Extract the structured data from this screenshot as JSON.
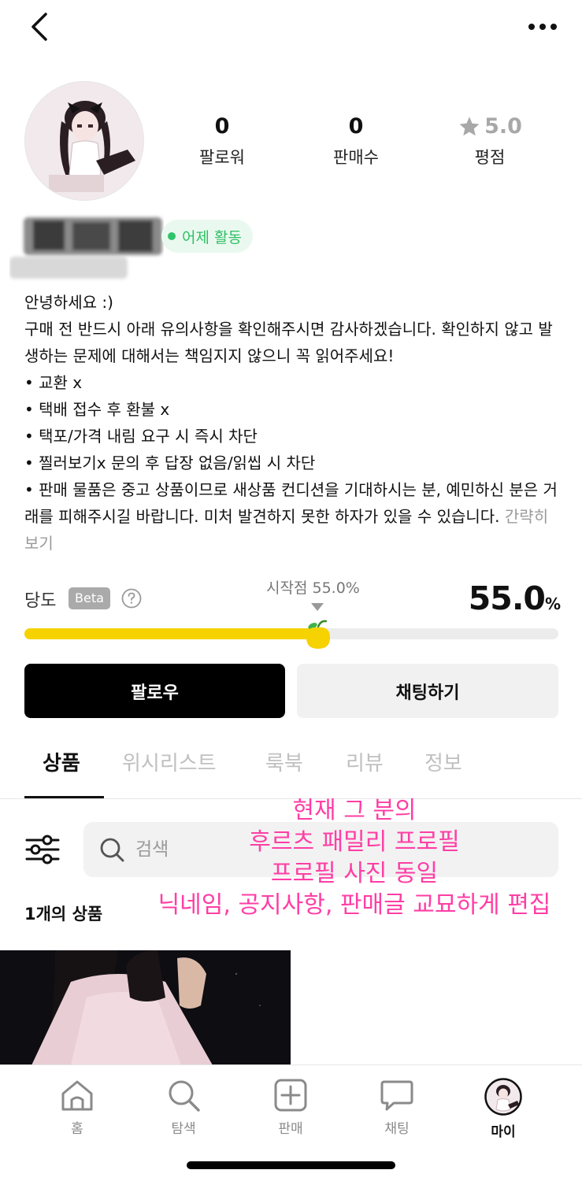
{
  "header": {
    "back_icon": "chevron-left-icon",
    "more_icon": "more-dots-icon"
  },
  "profile": {
    "stats": [
      {
        "value": "0",
        "label": "팔로워"
      },
      {
        "value": "0",
        "label": "판매수"
      },
      {
        "value": "5.0",
        "label": "평점"
      }
    ],
    "activity_status": "어제 활동",
    "activity_color": "#2fc46a",
    "bio_lines": [
      "안녕하세요 :)",
      "구매 전 반드시 아래 유의사항을 확인해주시면 감사하겠습니다. 확인하지 않고 발생하는 문제에 대해서는 책임지지 않으니 꼭 읽어주세요!",
      "• 교환 x",
      "• 택배 접수 후 환불 x",
      "• 택포/가격 내림 요구 시 즉시 차단",
      "• 찔러보기x 문의 후 답장 없음/읽씹 시 차단",
      "• 판매 물품은 중고 상품이므로 새상품 컨디션을 기대하시는 분, 예민하신 분은 거래를 피해주시길 바랍니다. 미처 발견하지 못한 하자가 있을 수 있습니다."
    ],
    "bio_collapse": "간략히 보기"
  },
  "sweetness": {
    "label": "당도",
    "badge": "Beta",
    "start_label": "시작점 55.0%",
    "value": "55.0",
    "unit": "%",
    "level": 0.55,
    "bar_color": "#f5d200"
  },
  "actions": {
    "follow": "팔로우",
    "chat": "채팅하기"
  },
  "tabs": [
    {
      "label": "상품",
      "active": true
    },
    {
      "label": "위시리스트",
      "active": false
    },
    {
      "label": "룩북",
      "active": false
    },
    {
      "label": "리뷰",
      "active": false
    },
    {
      "label": "정보",
      "active": false
    }
  ],
  "annotation": {
    "lines": [
      "현재 그 분의",
      "후르츠 패밀리 프로필",
      "프로필 사진 동일",
      "닉네임, 공지사항, 판매글 교묘하게 편집"
    ],
    "color": "#ff3ea5"
  },
  "search": {
    "placeholder": "검색"
  },
  "products": {
    "count_text": "1개의 상품"
  },
  "bottom_nav": [
    {
      "label": "홈",
      "icon": "home-icon",
      "active": false
    },
    {
      "label": "탐색",
      "icon": "search-icon",
      "active": false
    },
    {
      "label": "판매",
      "icon": "plus-square-icon",
      "active": false
    },
    {
      "label": "채팅",
      "icon": "chat-bubble-icon",
      "active": false
    },
    {
      "label": "마이",
      "icon": "avatar-icon",
      "active": true
    }
  ]
}
